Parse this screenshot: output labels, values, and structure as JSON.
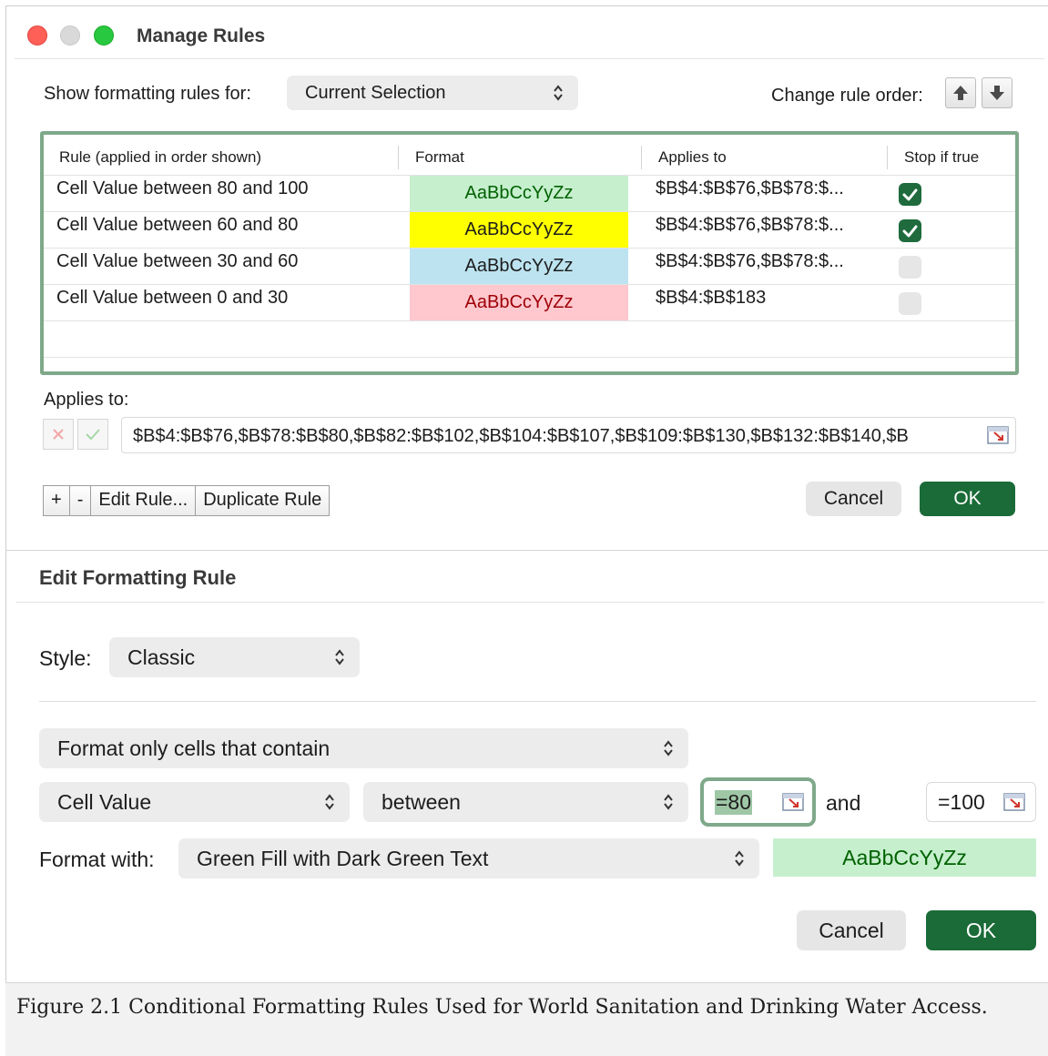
{
  "manage_rules": {
    "title": "Manage Rules",
    "show_label": "Show formatting rules for:",
    "show_value": "Current Selection",
    "order_label": "Change rule order:",
    "columns": [
      "Rule (applied in order shown)",
      "Format",
      "Applies to",
      "Stop if true"
    ],
    "rules": [
      {
        "rule": "Cell Value between 80 and 100",
        "format": "AaBbCcYyZz",
        "fill": "#c6efce",
        "text_color": "#006100",
        "applies": "$B$4:$B$76,$B$78:$...",
        "stop": true
      },
      {
        "rule": "Cell Value between 60 and 80",
        "format": "AaBbCcYyZz",
        "fill": "#ffff00",
        "text_color": "#1d1d1d",
        "applies": "$B$4:$B$76,$B$78:$...",
        "stop": true
      },
      {
        "rule": "Cell Value between 30 and 60",
        "format": "AaBbCcYyZz",
        "fill": "#bde3f0",
        "text_color": "#1d1d1d",
        "applies": "$B$4:$B$76,$B$78:$...",
        "stop": false
      },
      {
        "rule": "Cell Value between 0 and 30",
        "format": "AaBbCcYyZz",
        "fill": "#ffc7ce",
        "text_color": "#9c0006",
        "applies": "$B$4:$B$183",
        "stop": false
      }
    ],
    "applies_to_label": "Applies to:",
    "applies_to_value": "$B$4:$B$76,$B$78:$B$80,$B$82:$B$102,$B$104:$B$107,$B$109:$B$130,$B$132:$B$140,$B",
    "add_label": "+",
    "remove_label": "-",
    "edit_label": "Edit Rule...",
    "duplicate_label": "Duplicate Rule",
    "cancel_label": "Cancel",
    "ok_label": "OK"
  },
  "edit_rule": {
    "title": "Edit Formatting Rule",
    "style_label": "Style:",
    "style_value": "Classic",
    "type_value": "Format only cells that contain",
    "field_value": "Cell Value",
    "operator_value": "between",
    "value1": "=80",
    "and_label": "and",
    "value2": "=100",
    "format_with_label": "Format with:",
    "format_with_value": "Green Fill with Dark Green Text",
    "preview": "AaBbCcYyZz",
    "cancel_label": "Cancel",
    "ok_label": "OK"
  },
  "caption": "Figure 2.1 Conditional Formatting Rules Used for World Sanitation and Drinking Water Access.",
  "colors": {
    "accent_green": "#1a6b37",
    "table_border": "#7fa98a",
    "preview_fill": "#c6efce",
    "preview_text": "#006100"
  }
}
